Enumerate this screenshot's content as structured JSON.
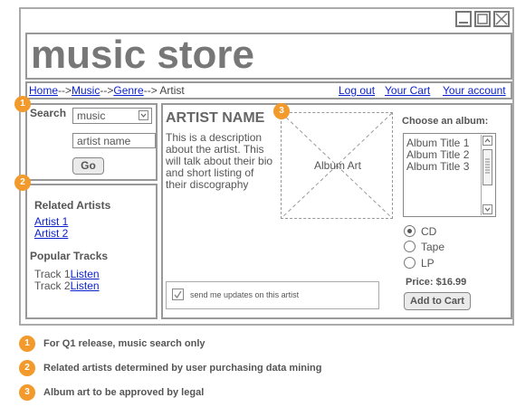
{
  "header": {
    "title": "music store"
  },
  "breadcrumb": [
    "Home",
    "Music",
    "Genre",
    "Artist"
  ],
  "breadcrumb_sep": "-->",
  "nav": {
    "logout": "Log out",
    "cart": "Your Cart",
    "account": "Your account"
  },
  "search": {
    "label": "Search",
    "category": "music",
    "artist_placeholder": "artist name",
    "go": "Go"
  },
  "sidebar": {
    "related_title": "Related Artists",
    "related": [
      "Artist 1",
      "Artist 2"
    ],
    "popular_title": "Popular Tracks",
    "tracks": [
      {
        "name": "Track 1",
        "action": "Listen"
      },
      {
        "name": "Track 2",
        "action": "Listen"
      }
    ]
  },
  "artist": {
    "name": "ARTIST NAME",
    "description": "This is a description about the artist. This will talk about their bio and short listing of their discography",
    "album_art": "Album Art",
    "updates_label": "send me updates on this artist",
    "updates_checked": true
  },
  "album": {
    "heading": "Choose an album:",
    "titles": [
      "Album Title 1",
      "Album Title 2",
      "Album Title 3"
    ],
    "formats": [
      {
        "label": "CD",
        "selected": true
      },
      {
        "label": "Tape",
        "selected": false
      },
      {
        "label": "LP",
        "selected": false
      }
    ],
    "price": "Price: $16.99",
    "add_to_cart": "Add to Cart"
  },
  "badges": [
    "1",
    "2",
    "3"
  ],
  "notes": [
    "For Q1 release, music search only",
    "Related artists determined by user purchasing data mining",
    "Album art to be approved by legal"
  ],
  "colors": {
    "badge": "#f39a2c",
    "link": "#0a1fcc"
  }
}
